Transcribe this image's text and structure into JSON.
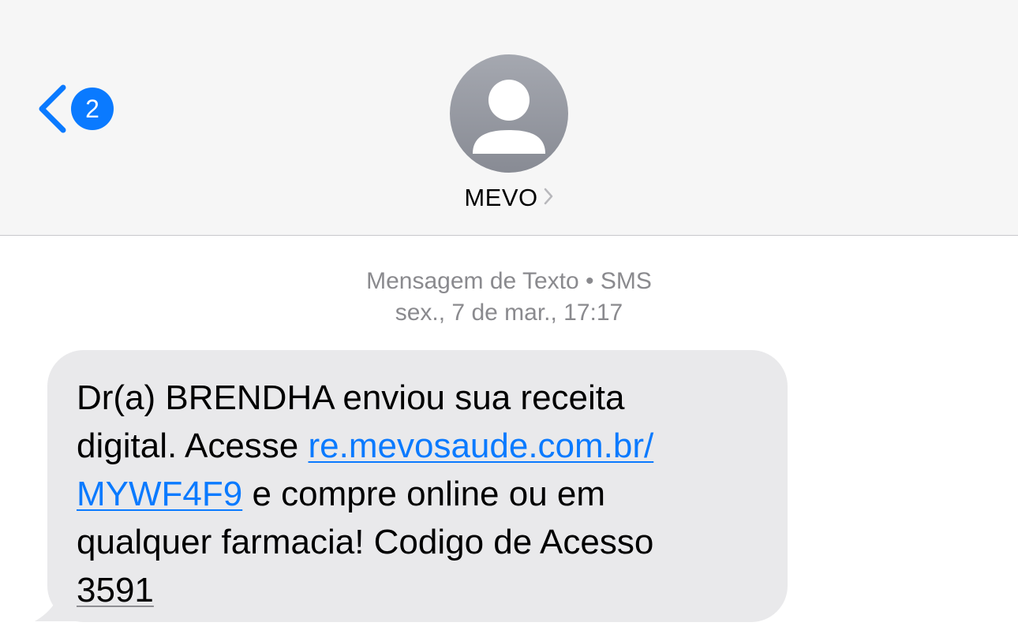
{
  "header": {
    "back_badge_count": "2",
    "contact_name": "MEVO",
    "icons": {
      "back": "chevron-left-icon",
      "avatar": "person-silhouette-icon",
      "contact_detail": "chevron-right-icon"
    }
  },
  "conversation": {
    "service_label": "Mensagem de Texto • SMS",
    "timestamp": "sex., 7 de mar., 17:17"
  },
  "message": {
    "line1": "Dr(a) BRENDHA enviou sua receita",
    "line2_text": "digital. Acesse ",
    "link_part1": "re.mevosaude.com.br/",
    "link_part2": "MYWF4F9",
    "line3_text": " e compre online ou em",
    "line4": "qualquer farmacia! Codigo de Acesso",
    "access_code": "3591"
  },
  "colors": {
    "accent": "#0a7aff",
    "bubble": "#e9e9eb",
    "header_bg": "#f6f6f6",
    "meta_text": "#8a8a8e"
  }
}
